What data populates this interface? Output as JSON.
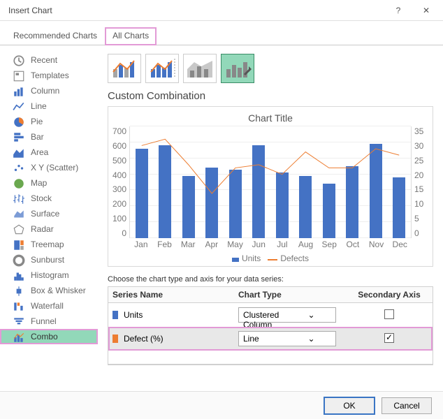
{
  "window": {
    "title": "Insert Chart",
    "help": "?",
    "close": "✕"
  },
  "tabs": {
    "recommended": "Recommended Charts",
    "all": "All Charts"
  },
  "sidebar": {
    "items": [
      {
        "label": "Recent"
      },
      {
        "label": "Templates"
      },
      {
        "label": "Column"
      },
      {
        "label": "Line"
      },
      {
        "label": "Pie"
      },
      {
        "label": "Bar"
      },
      {
        "label": "Area"
      },
      {
        "label": "X Y (Scatter)"
      },
      {
        "label": "Map"
      },
      {
        "label": "Stock"
      },
      {
        "label": "Surface"
      },
      {
        "label": "Radar"
      },
      {
        "label": "Treemap"
      },
      {
        "label": "Sunburst"
      },
      {
        "label": "Histogram"
      },
      {
        "label": "Box & Whisker"
      },
      {
        "label": "Waterfall"
      },
      {
        "label": "Funnel"
      },
      {
        "label": "Combo"
      }
    ]
  },
  "section_title": "Custom Combination",
  "chart_data": {
    "type": "combo",
    "title": "Chart Title",
    "categories": [
      "Jan",
      "Feb",
      "Mar",
      "Apr",
      "May",
      "Jun",
      "Jul",
      "Aug",
      "Sep",
      "Oct",
      "Nov",
      "Dec"
    ],
    "series": [
      {
        "name": "Units",
        "type": "bar",
        "axis": "primary",
        "values": [
          560,
          580,
          390,
          440,
          430,
          580,
          410,
          390,
          340,
          450,
          590,
          380
        ]
      },
      {
        "name": "Defects",
        "type": "line",
        "axis": "secondary",
        "values": [
          29,
          31,
          23,
          14,
          22,
          23,
          20,
          27,
          22,
          22,
          28,
          26
        ]
      }
    ],
    "y_primary": {
      "min": 0,
      "max": 700,
      "ticks": [
        0,
        100,
        200,
        300,
        400,
        500,
        600,
        700
      ]
    },
    "y_secondary": {
      "min": 0,
      "max": 35,
      "ticks": [
        0,
        5,
        10,
        15,
        20,
        25,
        30,
        35
      ]
    },
    "legend": [
      "Units",
      "Defects"
    ]
  },
  "grid": {
    "instruction": "Choose the chart type and axis for your data series:",
    "headers": {
      "name": "Series Name",
      "type": "Chart Type",
      "axis": "Secondary Axis"
    },
    "rows": [
      {
        "swatch": "bar",
        "name": "Units",
        "type": "Clustered Column",
        "secondary": false,
        "highlighted": false
      },
      {
        "swatch": "line",
        "name": "Defect (%)",
        "type": "Line",
        "secondary": true,
        "highlighted": true
      }
    ]
  },
  "buttons": {
    "ok": "OK",
    "cancel": "Cancel"
  }
}
